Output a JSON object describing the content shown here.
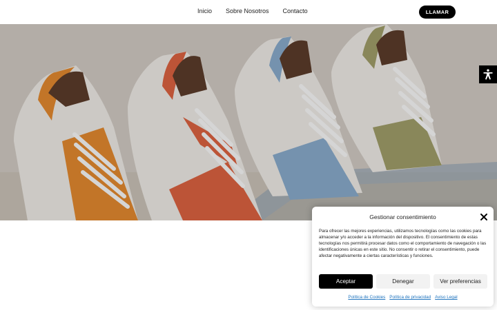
{
  "nav": {
    "items": [
      {
        "label": "Inicio"
      },
      {
        "label": "Sobre Nosotros"
      },
      {
        "label": "Contacto"
      }
    ],
    "call_label": "LLAMAR"
  },
  "hero": {
    "image": "sneakers-photo",
    "shoe_colors": [
      "#e88a2c",
      "#e1623f",
      "#8aaed0",
      "#a3a06a"
    ]
  },
  "accessibility": {
    "icon": "accessibility-icon"
  },
  "consent": {
    "title": "Gestionar consentimiento",
    "text": "Para ofrecer las mejores experiencias, utilizamos tecnologías como las cookies para almacenar y/o acceder a la información del dispositivo. El consentimiento de estas tecnologías nos permitirá procesar datos como el comportamiento de navegación o las identificaciones únicas en este sitio. No consentir o retirar el consentimiento, puede afectar negativamente a ciertas características y funciones.",
    "accept_label": "Aceptar",
    "deny_label": "Denegar",
    "prefs_label": "Ver preferencias",
    "links": [
      {
        "label": "Política de Cookies"
      },
      {
        "label": "Política de privacidad"
      },
      {
        "label": "Aviso Legal"
      }
    ]
  }
}
